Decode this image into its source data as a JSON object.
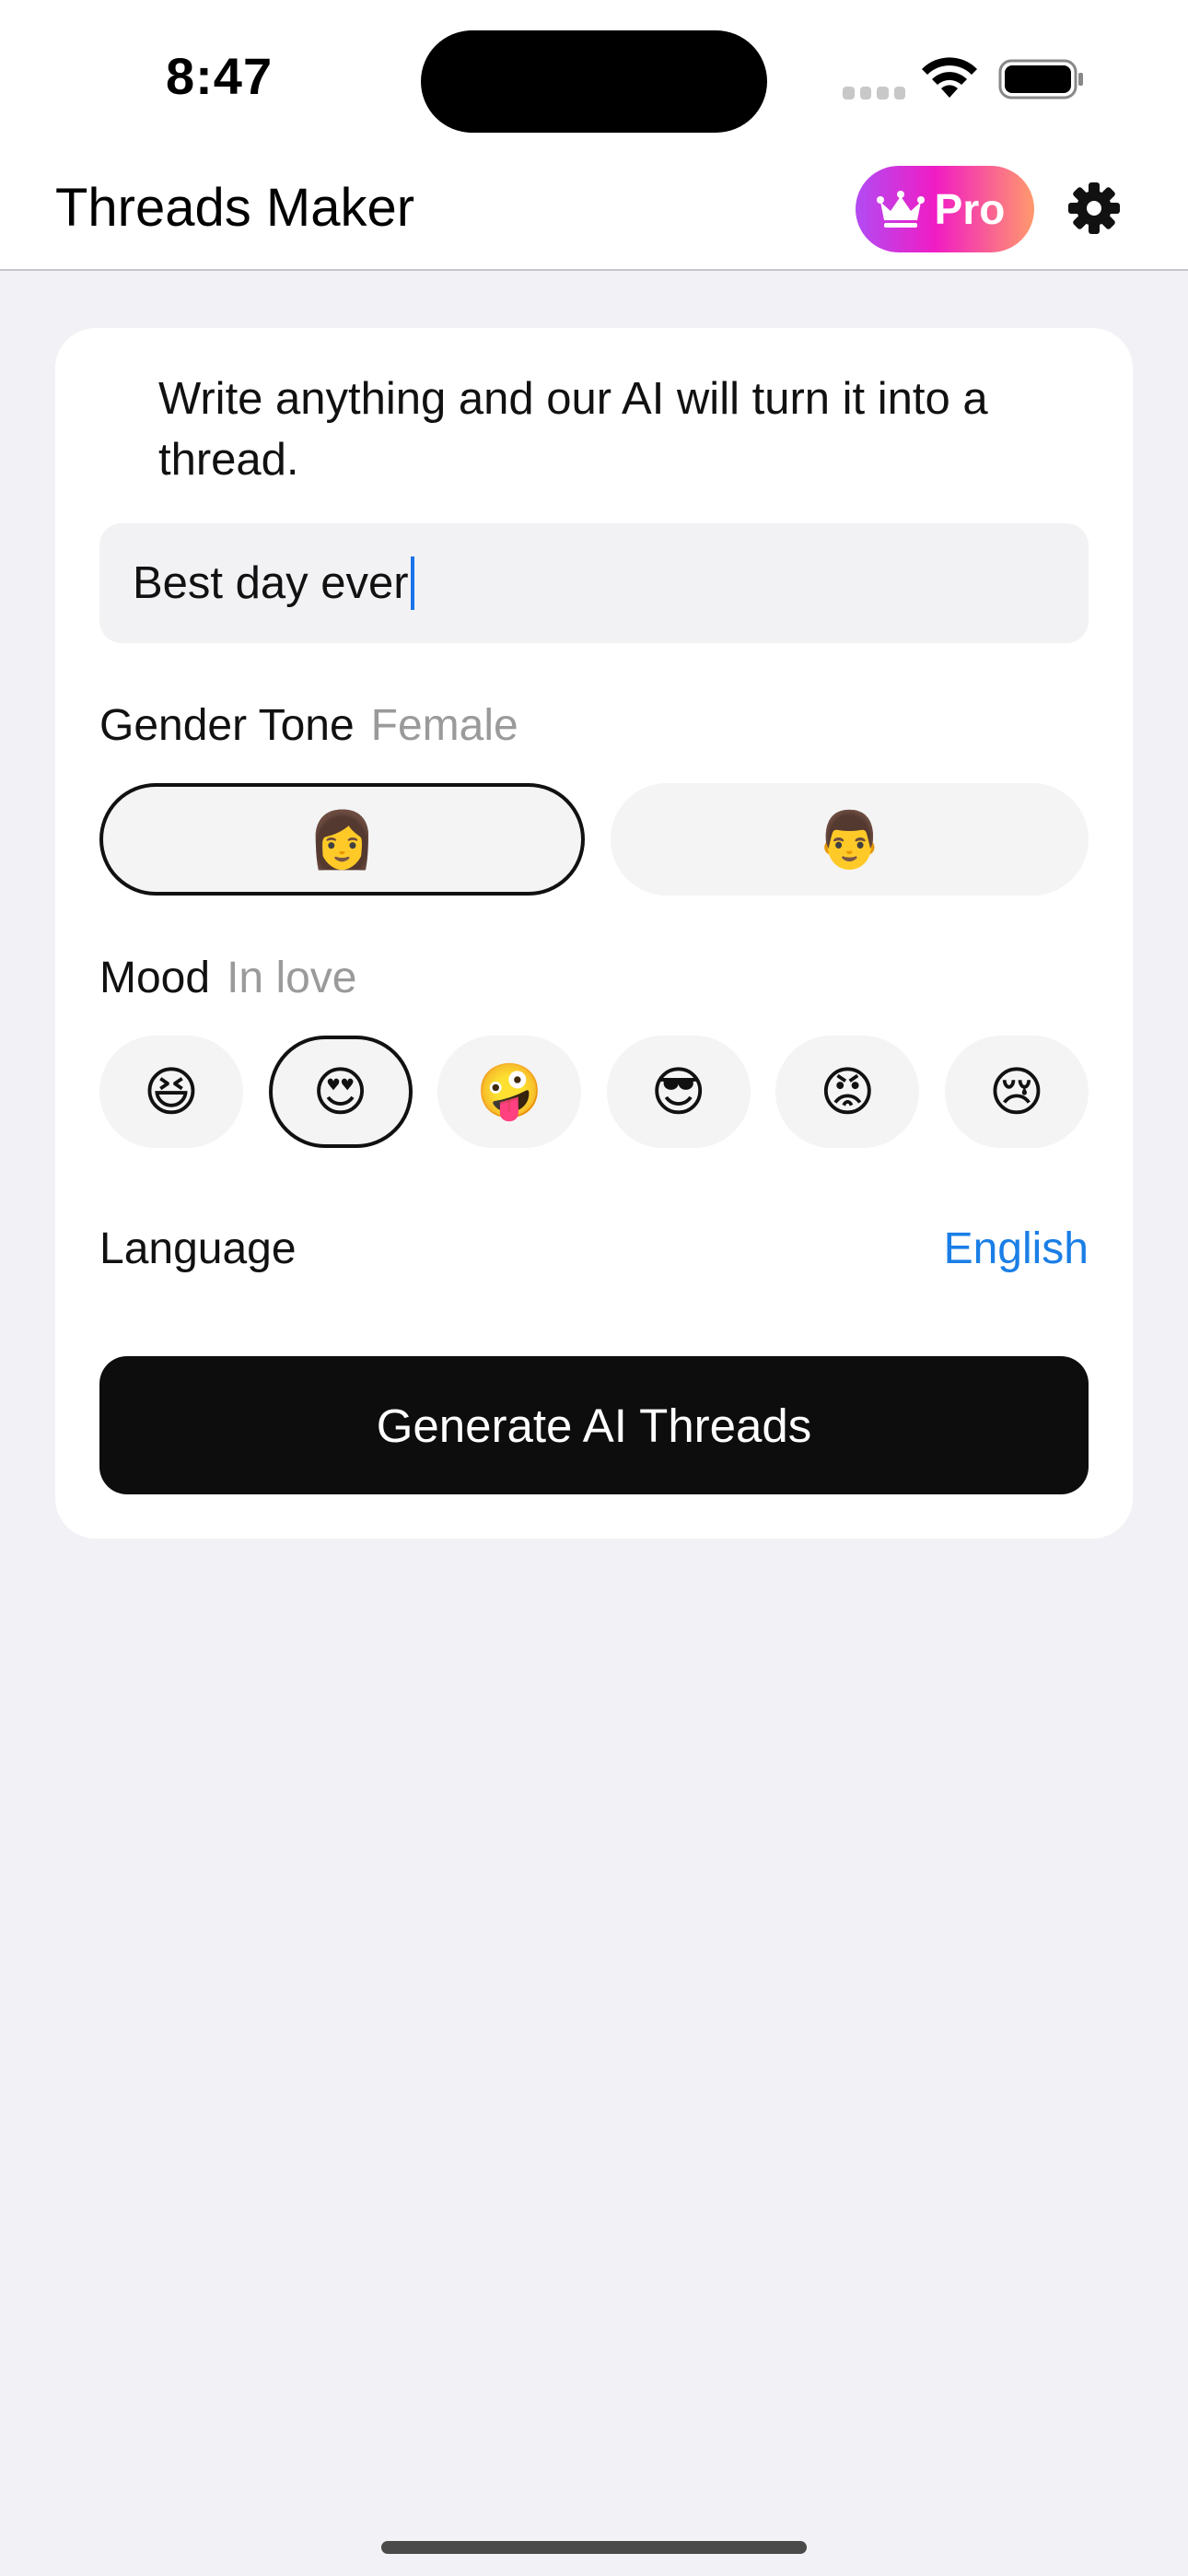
{
  "status_bar": {
    "time": "8:47"
  },
  "header": {
    "title": "Threads Maker",
    "pro_label": "Pro"
  },
  "form": {
    "intro": "Write anything and our AI will turn it into a thread.",
    "input_value": "Best day ever",
    "gender": {
      "label": "Gender Tone",
      "selected": "Female",
      "options": [
        "👩",
        "👨"
      ]
    },
    "mood": {
      "label": "Mood",
      "selected": "In love",
      "options": [
        "😆",
        "😍",
        "🤪",
        "😎",
        "😡",
        "😢"
      ]
    },
    "language": {
      "label": "Language",
      "value": "English"
    },
    "generate_label": "Generate AI Threads"
  },
  "colors": {
    "accent_blue": "#1a7ee6",
    "pro_gradient_start": "#b24bf3",
    "pro_gradient_end": "#ff9a6c",
    "button_dark": "#0d0d0d"
  }
}
